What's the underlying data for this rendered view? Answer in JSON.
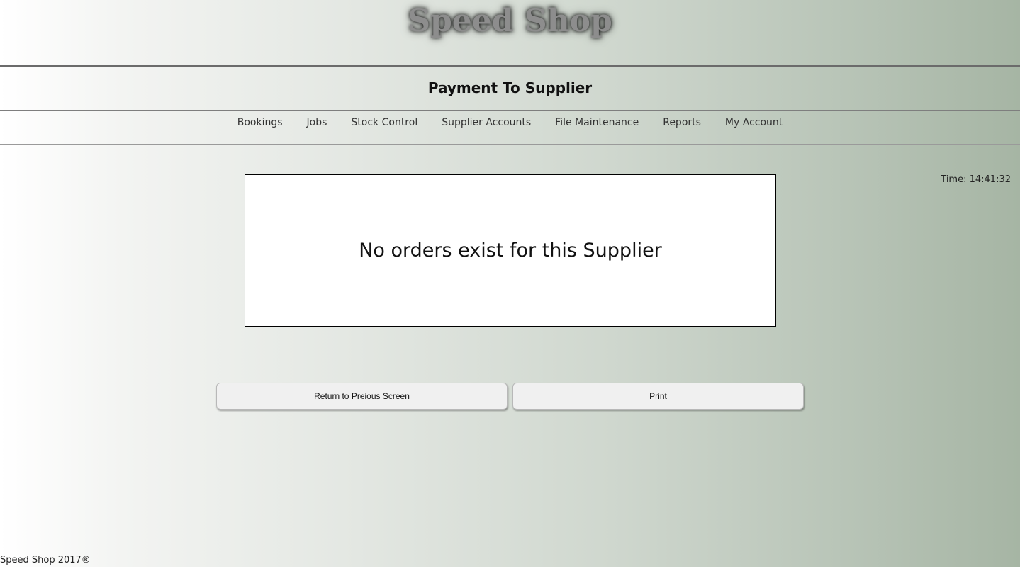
{
  "header": {
    "brand": "Speed Shop",
    "page_title": "Payment To Supplier"
  },
  "nav": {
    "items": [
      {
        "label": "Bookings"
      },
      {
        "label": "Jobs"
      },
      {
        "label": "Stock Control"
      },
      {
        "label": "Supplier Accounts"
      },
      {
        "label": "File Maintenance"
      },
      {
        "label": "Reports"
      },
      {
        "label": "My Account"
      }
    ]
  },
  "status": {
    "time_text": "Time: 14:41:32"
  },
  "main": {
    "message": "No orders exist for this Supplier",
    "buttons": {
      "return_label": "Return to Preious Screen",
      "print_label": "Print"
    }
  },
  "footer": {
    "text": "Speed Shop 2017®"
  },
  "colors": {
    "gradient_start": "#ffffff",
    "gradient_end": "#a6b5a4",
    "button_bg": "#f0f0f0",
    "box_bg": "#ffffff"
  }
}
